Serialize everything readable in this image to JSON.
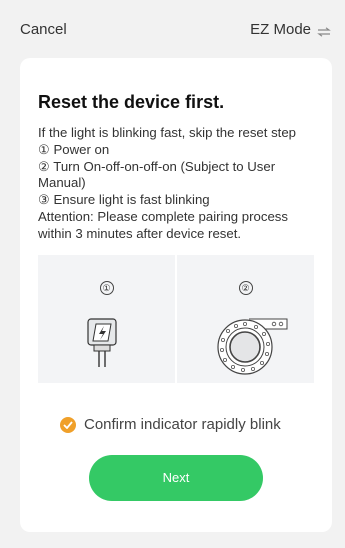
{
  "topbar": {
    "cancel_label": "Cancel",
    "mode_label": "EZ Mode",
    "mode_icon": "switch-arrows-icon"
  },
  "card": {
    "title": "Reset the device first.",
    "description_lines": [
      "If the light is blinking fast, skip the reset step",
      "① Power on",
      "② Turn On-off-on-off-on (Subject to User Manual)",
      "③ Ensure light is fast blinking",
      "Attention: Please complete pairing process within 3 minutes after device reset."
    ],
    "panels": [
      {
        "step": "①",
        "icon": "power-plug-icon"
      },
      {
        "step": "②",
        "icon": "led-strip-reel-icon"
      }
    ],
    "confirm_label": "Confirm indicator rapidly blink",
    "next_label": "Next"
  },
  "colors": {
    "background": "#f2f2f2",
    "card": "#ffffff",
    "accent_green": "#34c965",
    "check_orange": "#f0a02a",
    "panel_bg": "#f3f4f6"
  }
}
